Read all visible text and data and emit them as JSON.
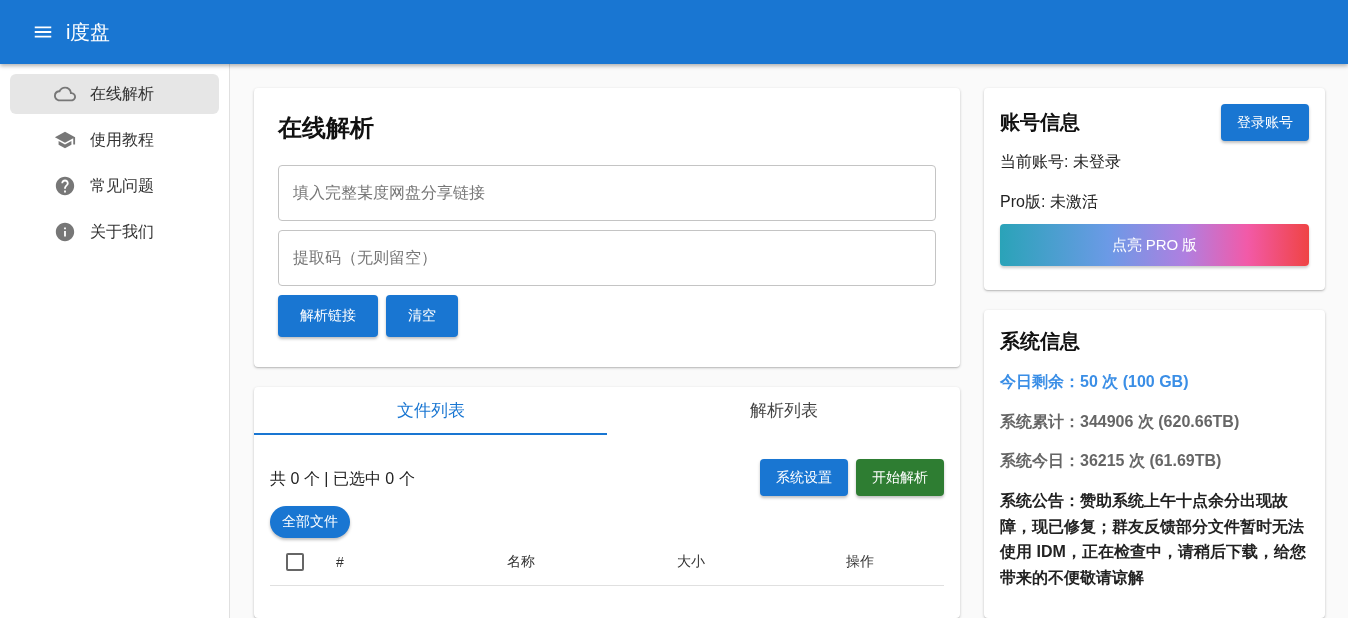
{
  "app_bar": {
    "title": "i度盘"
  },
  "sidebar": {
    "items": [
      {
        "label": "在线解析",
        "kind": "cloud",
        "selected": true
      },
      {
        "label": "使用教程",
        "kind": "school",
        "selected": false
      },
      {
        "label": "常见问题",
        "kind": "help",
        "selected": false
      },
      {
        "label": "关于我们",
        "kind": "info",
        "selected": false
      }
    ]
  },
  "parse_card": {
    "title": "在线解析",
    "link_field": {
      "placeholder": "填入完整某度网盘分享链接"
    },
    "code_field": {
      "placeholder": "提取码（无则留空）"
    },
    "buttons": [
      "解析链接",
      "清空"
    ]
  },
  "list_card": {
    "tabs": [
      {
        "label": "文件列表",
        "selected": true
      },
      {
        "label": "解析列表",
        "selected": false
      }
    ],
    "summary": "共 0 个 | 已选中 0 个",
    "settings_button": "系统设置",
    "start_button": "开始解析",
    "breadcrumb": "全部文件",
    "select_all": {
      "checked": false
    },
    "columns": [
      "#",
      "名称",
      "大小",
      "操作"
    ]
  },
  "account_card": {
    "title": "账号信息",
    "login_button": "登录账号",
    "lines": [
      "当前账号: 未登录",
      "Pro版: 未激活"
    ],
    "pro_button": "点亮 PRO 版"
  },
  "system_card": {
    "title": "系统信息",
    "remaining": "今日剩余：50 次 (100 GB)",
    "total": "系统累计：344906 次 (620.66TB)",
    "today": "系统今日：36215 次 (61.69TB)",
    "notice": "系统公告：赞助系统上午十点余分出现故障，现已修复；群友反馈部分文件暂时无法使用 IDM，正在检查中，请稍后下载，给您带来的不便敬请谅解"
  }
}
